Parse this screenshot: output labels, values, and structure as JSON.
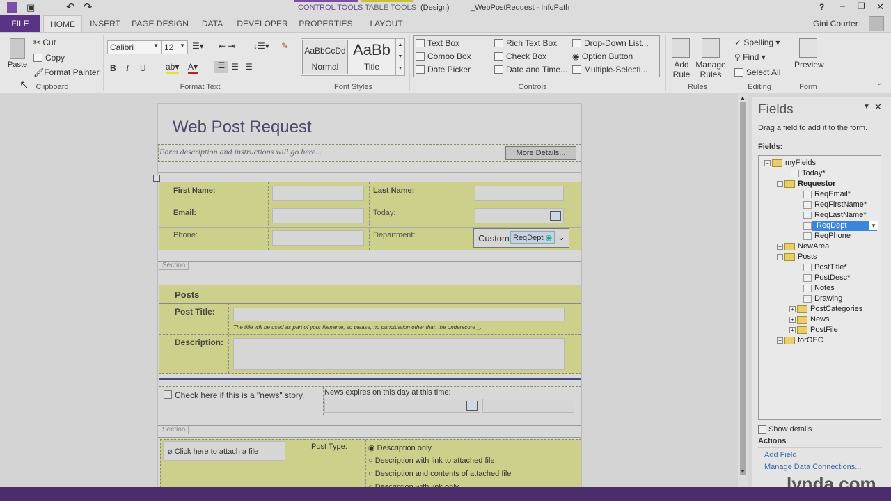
{
  "title_bar": {
    "contextual_tabs": [
      "CONTROL TOOLS",
      "TABLE TOOLS"
    ],
    "mode": "(Design)",
    "title": "_WebPostRequest - InfoPath",
    "help": "?",
    "user": "Gini Courter"
  },
  "tabs": [
    {
      "label": "FILE"
    },
    {
      "label": "HOME",
      "active": true
    },
    {
      "label": "INSERT"
    },
    {
      "label": "PAGE DESIGN"
    },
    {
      "label": "DATA"
    },
    {
      "label": "DEVELOPER"
    },
    {
      "label": "PROPERTIES"
    },
    {
      "label": "LAYOUT"
    }
  ],
  "ribbon": {
    "clipboard": {
      "paste": "Paste",
      "cut": "Cut",
      "copy": "Copy",
      "format_painter": "Format Painter",
      "label": "Clipboard"
    },
    "format_text": {
      "font": "Calibri",
      "size": "12",
      "bold": "B",
      "italic": "I",
      "underline": "U",
      "label": "Format Text"
    },
    "font_styles": {
      "normal": "Normal",
      "normal_sample": "AaBbCcDd",
      "title": "Title",
      "title_sample": "AaBb",
      "label": "Font Styles"
    },
    "controls": {
      "items": [
        "Text Box",
        "Combo Box",
        "Date Picker",
        "Rich Text Box",
        "Check Box",
        "Date and Time...",
        "Drop-Down List...",
        "Option Button",
        "Multiple-Selecti..."
      ],
      "label": "Controls"
    },
    "rules": {
      "add_rule": "Add Rule",
      "manage_rules": "Manage Rules",
      "label": "Rules"
    },
    "editing": {
      "spelling": "Spelling",
      "find": "Find",
      "select_all": "Select All",
      "label": "Editing"
    },
    "form": {
      "preview": "Preview",
      "label": "Form"
    }
  },
  "form": {
    "title": "Web Post Request",
    "description": "Form description and instructions will go here...",
    "more_details": "More Details...",
    "first_name": "First Name:",
    "last_name": "Last Name:",
    "email": "Email:",
    "today": "Today:",
    "phone": "Phone:",
    "department": "Department:",
    "dept_value": "Custom",
    "dept_tag": "ReqDept",
    "section": "Section",
    "posts": "Posts",
    "post_title": "Post Title:",
    "post_title_hint": "The title will be used as part of your filename, so please, no punctuation other than the underscore _.",
    "description_label": "Description:",
    "news_check": "Check here if this is a \"news\" story.",
    "news_expires": "News expires on this day at this time:",
    "attach": "Click here to attach a file",
    "post_type": "Post Type:",
    "post_type_options": [
      {
        "label": "Description only",
        "selected": true
      },
      {
        "label": "Description with link to attached file"
      },
      {
        "label": "Description and contents of attached file"
      },
      {
        "label": "Description with link only"
      }
    ]
  },
  "fields_panel": {
    "title": "Fields",
    "hint": "Drag a field to add it to the form.",
    "fields_label": "Fields:",
    "tree": [
      {
        "name": "myFields",
        "level": 0,
        "type": "group",
        "expanded": true
      },
      {
        "name": "Today*",
        "level": 1,
        "type": "field"
      },
      {
        "name": "Requestor",
        "level": 1,
        "type": "group",
        "expanded": true,
        "bold": true
      },
      {
        "name": "ReqEmail*",
        "level": 2,
        "type": "field"
      },
      {
        "name": "ReqFirstName*",
        "level": 2,
        "type": "field"
      },
      {
        "name": "ReqLastName*",
        "level": 2,
        "type": "field"
      },
      {
        "name": "ReqDept",
        "level": 2,
        "type": "field",
        "selected": true
      },
      {
        "name": "ReqPhone",
        "level": 2,
        "type": "field"
      },
      {
        "name": "NewArea",
        "level": 1,
        "type": "group",
        "expanded": false
      },
      {
        "name": "Posts",
        "level": 1,
        "type": "group",
        "expanded": true
      },
      {
        "name": "PostTitle*",
        "level": 2,
        "type": "field"
      },
      {
        "name": "PostDesc*",
        "level": 2,
        "type": "field"
      },
      {
        "name": "Notes",
        "level": 2,
        "type": "field"
      },
      {
        "name": "Drawing",
        "level": 2,
        "type": "field"
      },
      {
        "name": "PostCategories",
        "level": 2,
        "type": "group",
        "expanded": false
      },
      {
        "name": "News",
        "level": 2,
        "type": "group",
        "expanded": false
      },
      {
        "name": "PostFile",
        "level": 2,
        "type": "group",
        "expanded": false
      },
      {
        "name": "forOEC",
        "level": 1,
        "type": "group",
        "expanded": false
      }
    ],
    "show_details": "Show details",
    "actions": "Actions",
    "add_field": "Add Field",
    "manage_connections": "Manage Data Connections..."
  },
  "watermark": "lynda.com",
  "colors": {
    "accent": "#4b2d6b",
    "control_tools": "#7a4fa3",
    "table_tools": "#c8c23a",
    "section_fill": "#cdd08a",
    "selection": "#3a86d8"
  }
}
